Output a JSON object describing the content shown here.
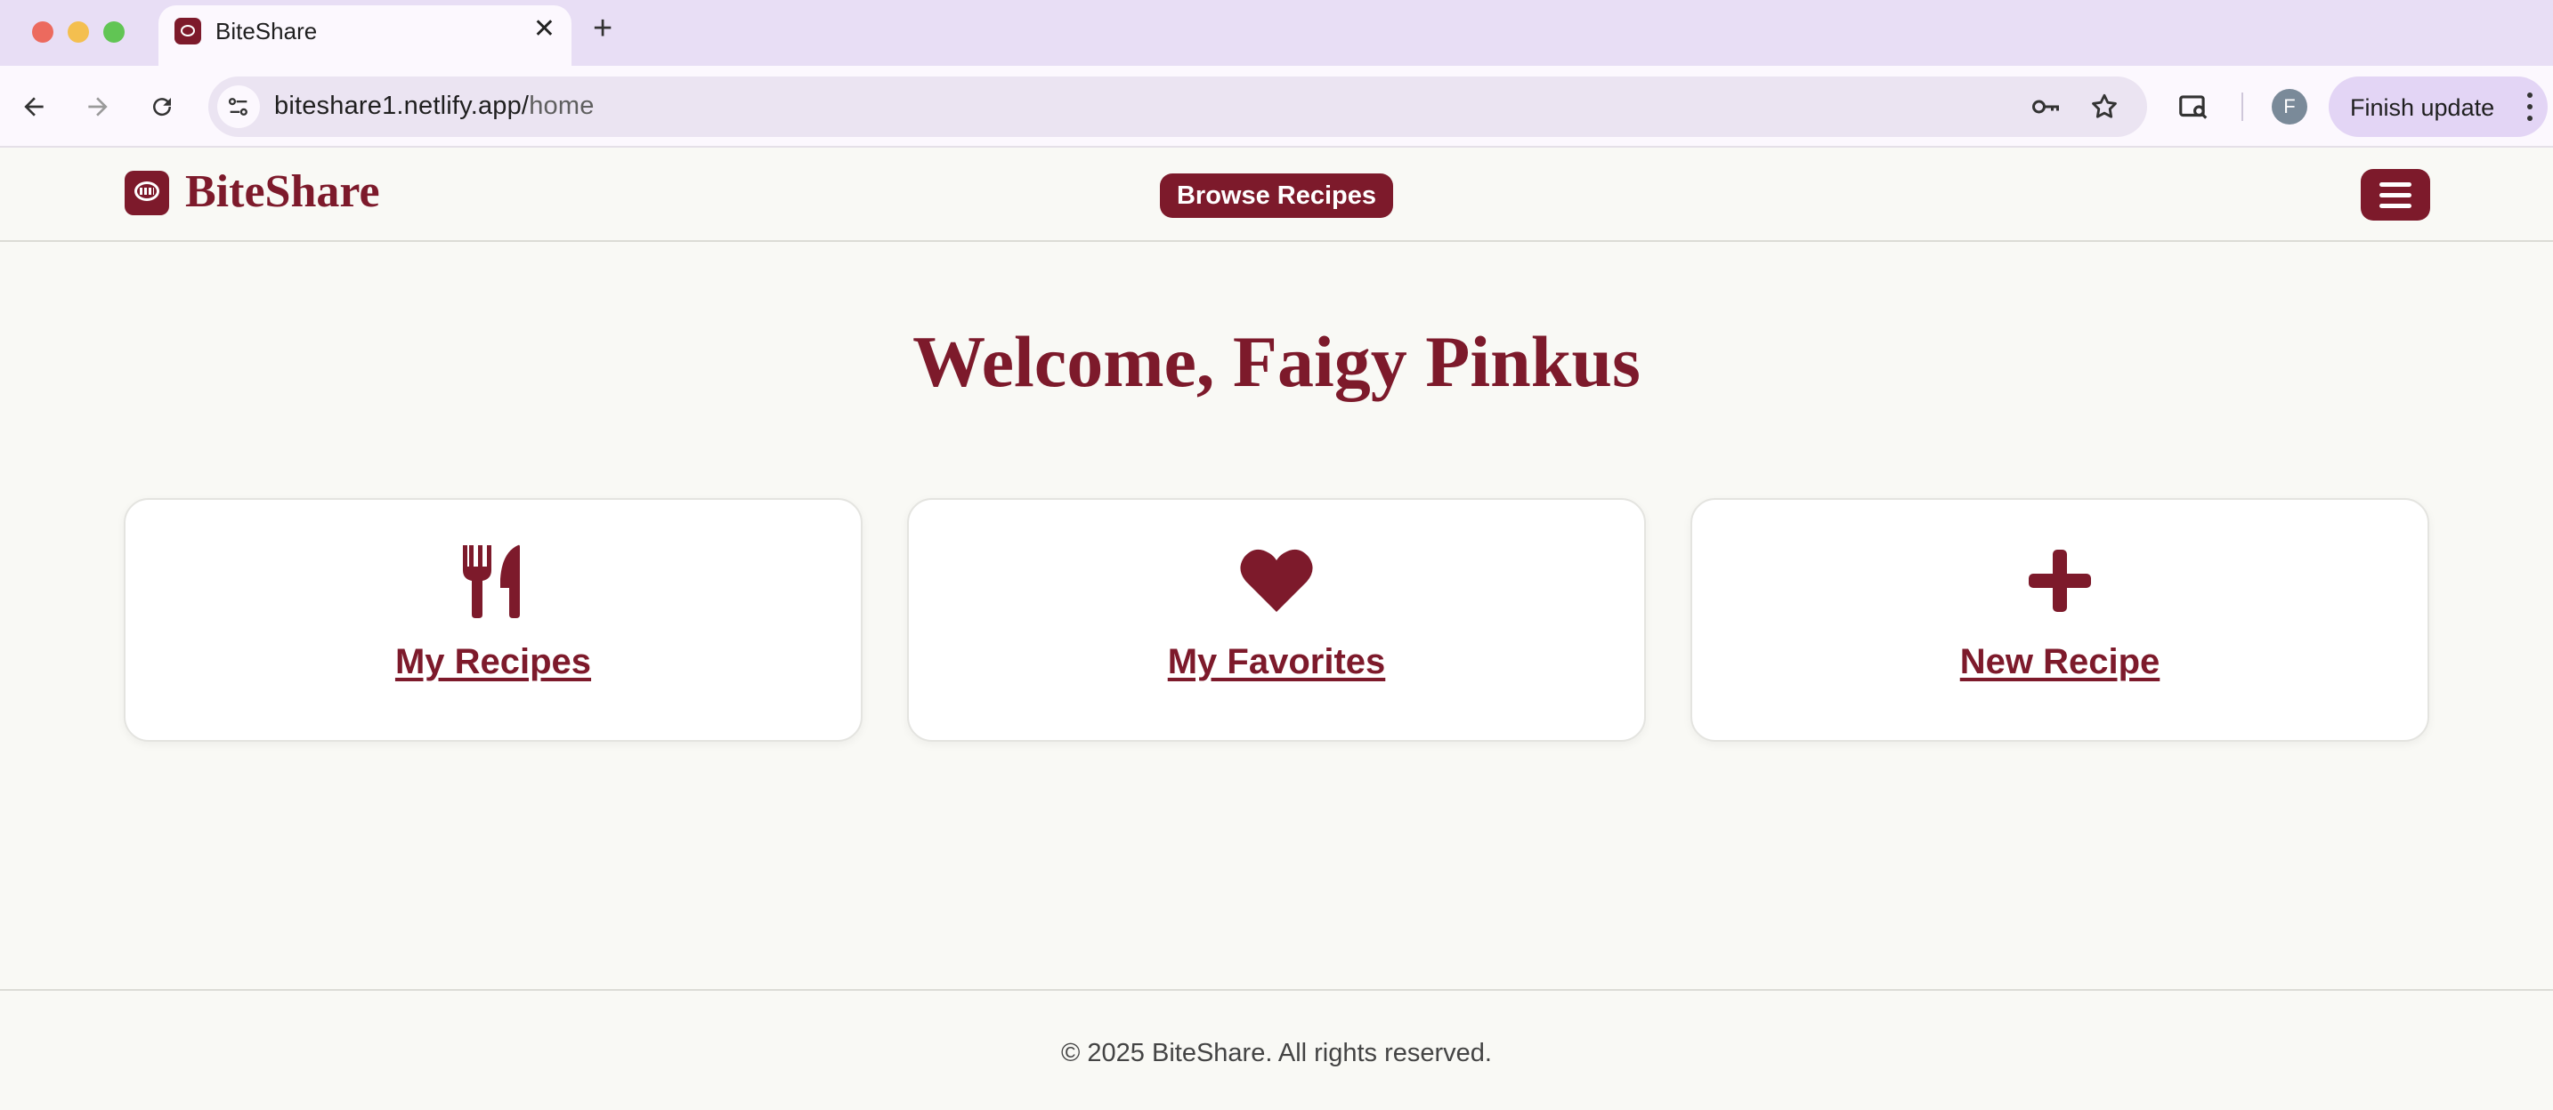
{
  "browser": {
    "tab_title": "BiteShare",
    "url_host": "biteshare1.netlify.app/",
    "url_path": "home",
    "avatar_letter": "F",
    "update_label": "Finish update"
  },
  "header": {
    "logo_text": "BiteShare",
    "browse_label": "Browse Recipes"
  },
  "main": {
    "welcome": "Welcome, Faigy Pinkus",
    "cards": [
      {
        "label": "My Recipes",
        "icon": "utensils-icon"
      },
      {
        "label": "My Favorites",
        "icon": "heart-icon"
      },
      {
        "label": "New Recipe",
        "icon": "plus-icon"
      }
    ]
  },
  "footer": {
    "text": "© 2025 BiteShare. All rights reserved."
  },
  "colors": {
    "brand": "#7d1a2b",
    "page_bg": "#f9f9f5",
    "chrome_tabstrip": "#e8def5"
  }
}
